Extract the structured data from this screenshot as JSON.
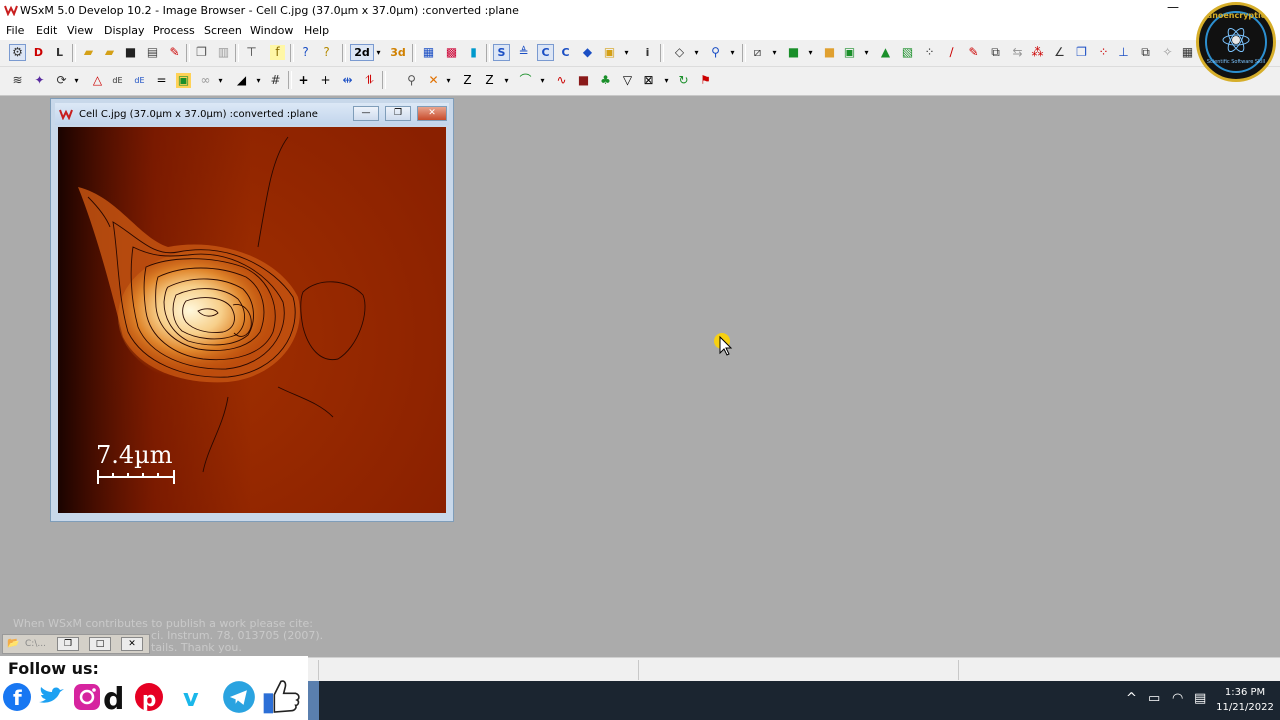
{
  "app": {
    "title": "WSxM 5.0 Develop 10.2 - Image Browser - Cell C.jpg (37.0µm x 37.0µm) :converted :plane",
    "minimize_glyph": "—"
  },
  "menu": [
    "File",
    "Edit",
    "View",
    "Display",
    "Process",
    "Screen",
    "Window",
    "Help"
  ],
  "toolbar": {
    "btn_2d": "2d",
    "btn_3d": "3d",
    "btn_s": "S",
    "btn_c": "C"
  },
  "badge": {
    "text": "Nanoencryption",
    "sub": "Scientific Software Skill"
  },
  "image_window": {
    "title": "Cell C.jpg (37.0µm x 37.0µm) :converted :plane",
    "scale_bar_label": "7.4µm",
    "minimize": "—",
    "restore": "❐",
    "close": "✕"
  },
  "citation": {
    "line1": "When WSxM contributes to publish a work please cite:",
    "line2": "ci. Instrum. 78, 013705 (2007).",
    "line3": "tails. Thank you."
  },
  "mini_window": {
    "label": "C:\\...",
    "restore": "❐",
    "maximize": "□",
    "close": "✕"
  },
  "social": {
    "follow": "Follow us:",
    "icons": [
      "facebook-icon",
      "twitter-icon",
      "instagram-icon",
      "dailymotion-icon",
      "pinterest-icon",
      "vimeo-icon",
      "telegram-icon",
      "like-icon"
    ]
  },
  "taskbar": {
    "time": "1:36 PM",
    "date": "11/21/2022"
  },
  "colors": {
    "afm_dark": "#6a1200",
    "afm_mid": "#b43c00",
    "afm_bright": "#fff3cc",
    "cursor_highlight": "#ffd400"
  }
}
